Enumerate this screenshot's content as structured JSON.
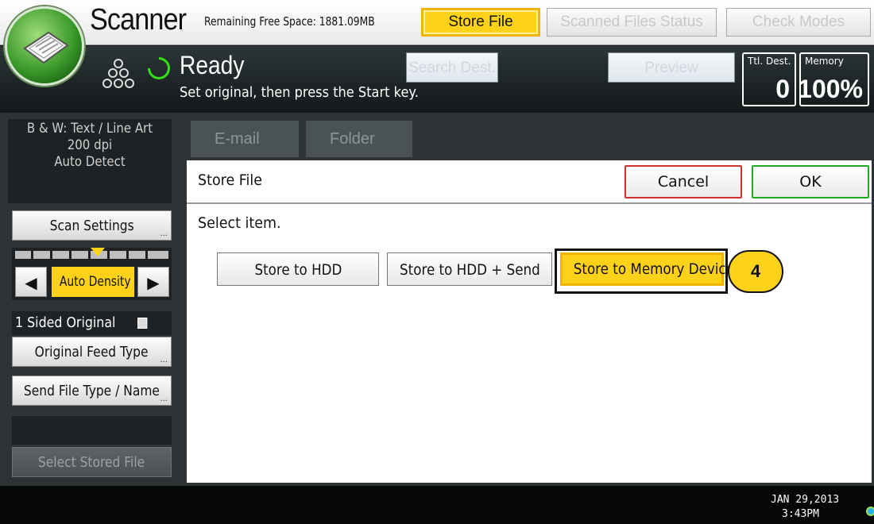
{
  "header": {
    "app_title": "Scanner",
    "free_space": "Remaining Free Space: 1881.09MB",
    "store_file_tab": "Store File",
    "scanned_status_tab": "Scanned Files Status",
    "check_modes_tab": "Check Modes"
  },
  "status": {
    "state": "Ready",
    "message": "Set original, then press the Start key.",
    "search_dest_label": "Search Dest.",
    "preview_label": "Preview",
    "total_dest_label": "Ttl. Dest.",
    "total_dest_value": "0",
    "memory_label": "Memory",
    "memory_value": "100%"
  },
  "left_panel": {
    "info_line1": "B & W: Text / Line Art",
    "info_line2": "200 dpi",
    "info_line3": "Auto Detect",
    "scan_settings": "Scan Settings",
    "auto_density": "Auto Density",
    "sided_original": "1 Sided Original",
    "original_feed_type": "Original Feed Type",
    "send_file_type": "Send File Type / Name",
    "select_stored_file": "Select Stored File"
  },
  "dest_tabs": {
    "email": "E-mail",
    "folder": "Folder"
  },
  "dialog": {
    "title": "Store File",
    "cancel": "Cancel",
    "ok": "OK",
    "prompt": "Select item.",
    "options": [
      "Store to HDD",
      "Store to HDD + Send",
      "Store to Memory Device"
    ],
    "selected_option": "Store to Memory Device",
    "step_badge": "4"
  },
  "footer": {
    "date": "JAN  29,2013",
    "time": "3:43PM"
  },
  "colors": {
    "accent_yellow": "#ffd21a",
    "ready_green": "#34e014",
    "cancel_border": "#d03030",
    "ok_border": "#22aa22"
  }
}
